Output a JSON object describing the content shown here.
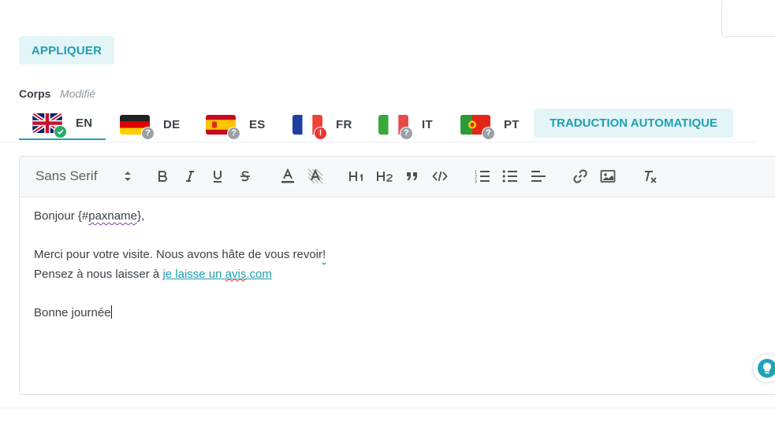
{
  "actions": {
    "apply_label": "APPLIQUER"
  },
  "section": {
    "title": "Corps",
    "status": "Modifié"
  },
  "languages": [
    {
      "code": "EN",
      "status": "translated"
    },
    {
      "code": "DE",
      "status": "unknown"
    },
    {
      "code": "ES",
      "status": "unknown"
    },
    {
      "code": "FR",
      "status": "error"
    },
    {
      "code": "IT",
      "status": "unknown"
    },
    {
      "code": "PT",
      "status": "unknown"
    }
  ],
  "active_language": "EN",
  "auto_translate_label": "TRADUCTION AUTOMATIQUE",
  "toolbar": {
    "font": "Sans Serif"
  },
  "editor": {
    "greeting_prefix": "Bonjour {#",
    "greeting_var": "paxname",
    "greeting_suffix": "},",
    "line1_text": "Merci pour votre visite. Nous avons hâte de vous revoir",
    "line1_punct": "!",
    "line2_prefix": "Pensez à nous laisser à ",
    "line2_link_a": "je laisse un ",
    "line2_link_b": "avis",
    "line2_link_c": ".com",
    "closing": "Bonne journée"
  },
  "colors": {
    "accent": "#1fa3b5",
    "accent_bg": "#e3f5f7",
    "ok": "#2aaa6a",
    "error": "#e53935",
    "unknown": "#9aa0a6"
  }
}
